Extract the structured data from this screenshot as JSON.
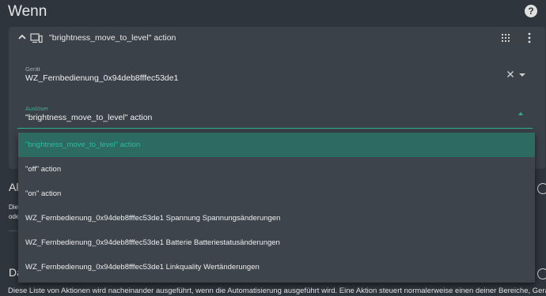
{
  "header": {
    "title": "Wenn",
    "help_icon": "help-circle-icon"
  },
  "trigger_card": {
    "title": "\"brightness_move_to_level\" action",
    "icons": {
      "collapse": "chevron-up-icon",
      "device": "device-icon",
      "reorder": "drag-grid-icon",
      "menu": "more-vert-icon"
    },
    "device_field": {
      "label": "Gerät",
      "value": "WZ_Fernbedienung_0x94deb8fffec53de1"
    },
    "trigger_field": {
      "label": "Auslöser",
      "value": "\"brightness_move_to_level\" action"
    }
  },
  "dropdown": {
    "options": [
      "\"brightness_move_to_level\" action",
      "\"off\" action",
      "\"on\" action",
      "WZ_Fernbedienung_0x94deb8fffec53de1 Spannung Spannungsänderungen",
      "WZ_Fernbedienung_0x94deb8fffec53de1 Batterie Batteriestatusänderungen",
      "WZ_Fernbedienung_0x94deb8fffec53de1 Linkquality Wertänderungen"
    ],
    "selected_index": 0
  },
  "background": {
    "section_conditions_fragment": "Al",
    "conditions_text_fragment_1": "Die",
    "conditions_text_fragment_2": "ode",
    "section_actions_fragment": "Da",
    "actions_description": "Diese Liste von Aktionen wird nacheinander ausgeführt, wenn die Automatisierung ausgeführt wird. Eine Aktion steuert normalerweise einen deiner Bereiche, Geräte"
  },
  "colors": {
    "background": "#2f353d",
    "card": "#3b4149",
    "accent": "#2bb29a",
    "selected_bg": "#2c6a62"
  }
}
